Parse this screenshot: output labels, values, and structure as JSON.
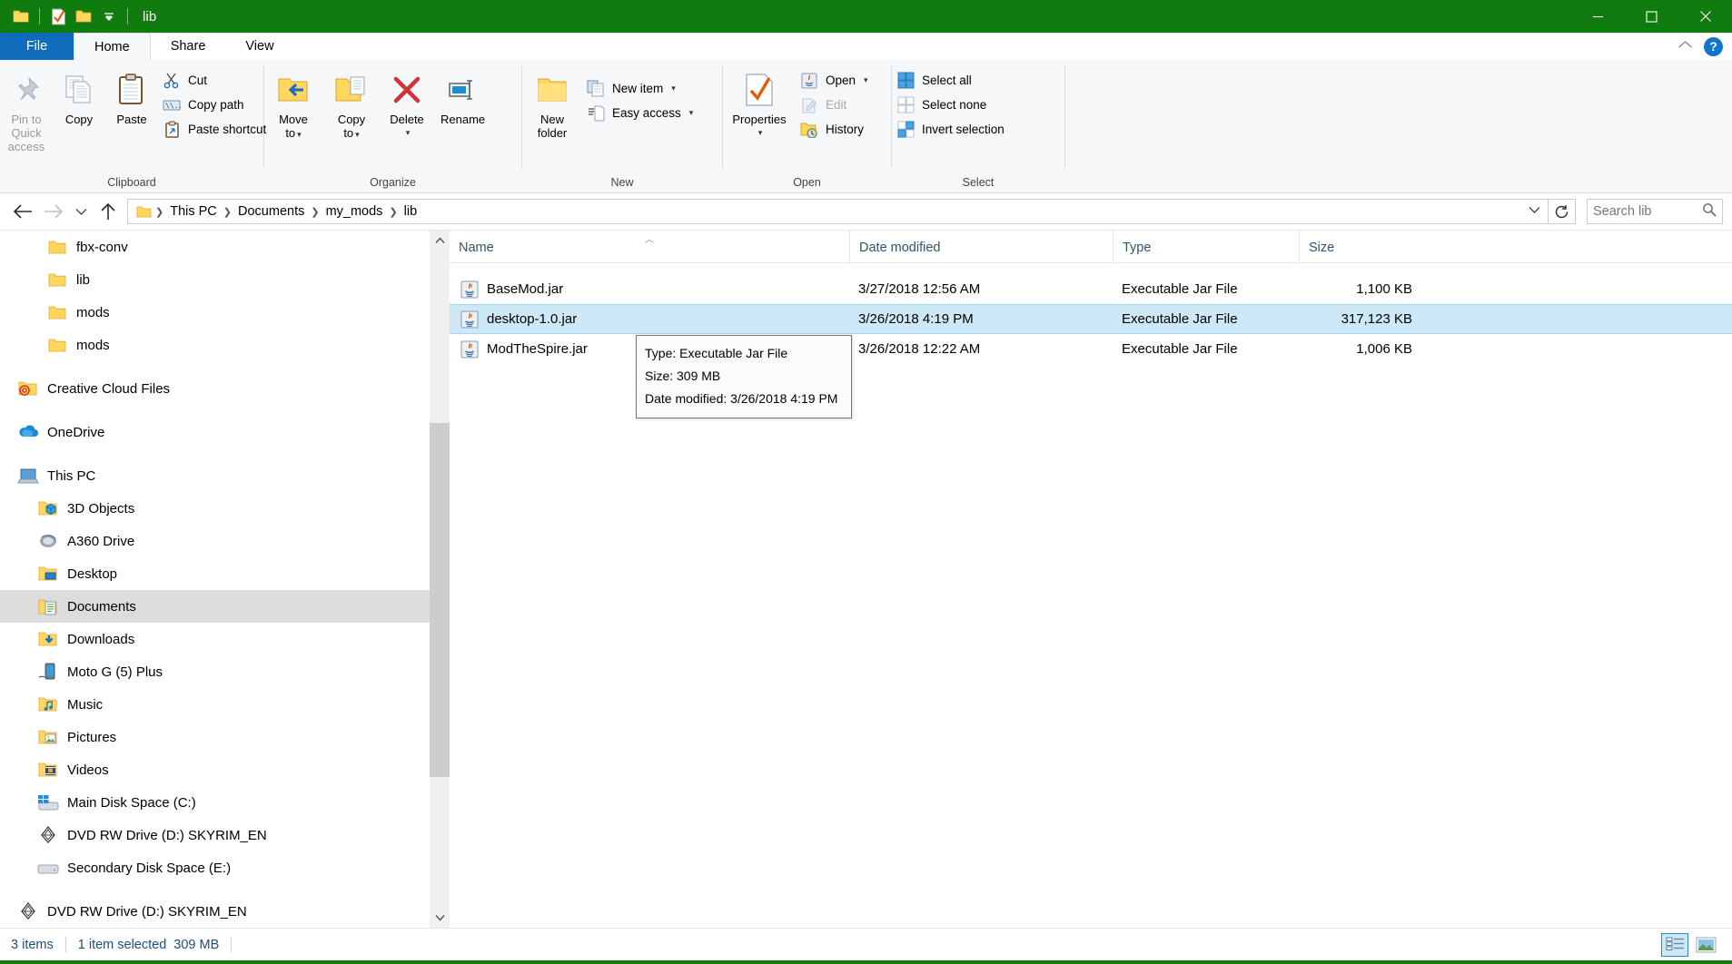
{
  "window": {
    "title": "lib",
    "accent_green": "#107c10",
    "selection_blue": "#cde8f7",
    "controls": {
      "minimize": "minimize-button",
      "maximize": "maximize-button",
      "close": "close-button"
    }
  },
  "quick_access": {
    "items": [
      "folder-icon",
      "properties-check-icon",
      "new-folder-icon",
      "customize-chevron-icon"
    ]
  },
  "tabs": [
    {
      "label": "File",
      "id": "file"
    },
    {
      "label": "Home",
      "id": "home"
    },
    {
      "label": "Share",
      "id": "share"
    },
    {
      "label": "View",
      "id": "view"
    }
  ],
  "ribbon": {
    "collapse_icon": "chevron-up-icon",
    "help_label": "?",
    "groups": [
      {
        "label": "Clipboard",
        "big": [
          {
            "label": "Pin to Quick\naccess",
            "label_line1": "Pin to Quick",
            "label_line2": "access",
            "icon": "pin-icon",
            "disabled": true
          },
          {
            "label": "Copy",
            "icon": "copy-icon",
            "disabled": false
          },
          {
            "label": "Paste",
            "icon": "paste-icon",
            "disabled": false
          }
        ],
        "small": [
          {
            "label": "Cut",
            "icon": "scissors-icon"
          },
          {
            "label": "Copy path",
            "icon": "copy-path-icon"
          },
          {
            "label": "Paste shortcut",
            "icon": "paste-shortcut-icon"
          }
        ]
      },
      {
        "label": "Organize",
        "big": [
          {
            "label_line1": "Move",
            "label_line2": "to",
            "icon": "move-to-icon",
            "caret": true
          },
          {
            "label_line1": "Copy",
            "label_line2": "to",
            "icon": "copy-to-icon",
            "caret": true
          },
          {
            "label_line1": "Delete",
            "label_line2": "",
            "icon": "delete-x-icon",
            "caret": true
          },
          {
            "label_line1": "Rename",
            "label_line2": "",
            "icon": "rename-icon",
            "caret": false
          }
        ],
        "small": []
      },
      {
        "label": "New",
        "big": [
          {
            "label_line1": "New",
            "label_line2": "folder",
            "icon": "new-folder-icon",
            "caret": false
          }
        ],
        "small": [
          {
            "label": "New item",
            "icon": "new-item-icon",
            "caret": true
          },
          {
            "label": "Easy access",
            "icon": "easy-access-icon",
            "caret": true
          }
        ]
      },
      {
        "label": "Open",
        "big": [
          {
            "label_line1": "Properties",
            "label_line2": "",
            "icon": "properties-icon",
            "caret": true
          }
        ],
        "small": [
          {
            "label": "Open",
            "icon": "java-open-icon",
            "caret": true
          },
          {
            "label": "Edit",
            "icon": "edit-icon",
            "disabled": true
          },
          {
            "label": "History",
            "icon": "history-icon"
          }
        ]
      },
      {
        "label": "Select",
        "big": [],
        "small": [
          {
            "label": "Select all",
            "icon": "select-all-icon"
          },
          {
            "label": "Select none",
            "icon": "select-none-icon"
          },
          {
            "label": "Invert selection",
            "icon": "invert-selection-icon"
          }
        ]
      }
    ]
  },
  "addressbar": {
    "back_icon": "back-arrow-icon",
    "forward_icon": "forward-arrow-icon",
    "recent_icon": "recent-locations-chevron-icon",
    "up_icon": "up-arrow-icon",
    "folder_icon": "folder-icon",
    "breadcrumbs": [
      "This PC",
      "Documents",
      "my_mods",
      "lib"
    ],
    "dropdown_icon": "chevron-down-icon",
    "refresh_icon": "refresh-icon",
    "search_placeholder": "Search lib",
    "search_value": "",
    "search_icon": "search-icon"
  },
  "navigation_pane": {
    "items": [
      {
        "label": "fbx-conv",
        "icon": "folder-icon",
        "indent": 2,
        "selected": false
      },
      {
        "label": "lib",
        "icon": "folder-icon",
        "indent": 2,
        "selected": false
      },
      {
        "label": "mods",
        "icon": "folder-icon",
        "indent": 2,
        "selected": false
      },
      {
        "label": "mods",
        "icon": "folder-icon",
        "indent": 2,
        "selected": false
      },
      {
        "label": "Creative Cloud Files",
        "icon": "creative-cloud-icon",
        "indent": 0,
        "selected": false,
        "gap_before": true
      },
      {
        "label": "OneDrive",
        "icon": "onedrive-icon",
        "indent": 0,
        "selected": false,
        "gap_before": true
      },
      {
        "label": "This PC",
        "icon": "this-pc-icon",
        "indent": 0,
        "selected": false,
        "gap_before": true
      },
      {
        "label": "3D Objects",
        "icon": "3d-objects-icon",
        "indent": 1,
        "selected": false
      },
      {
        "label": "A360 Drive",
        "icon": "a360-drive-icon",
        "indent": 1,
        "selected": false
      },
      {
        "label": "Desktop",
        "icon": "desktop-folder-icon",
        "indent": 1,
        "selected": false
      },
      {
        "label": "Documents",
        "icon": "documents-folder-icon",
        "indent": 1,
        "selected": true
      },
      {
        "label": "Downloads",
        "icon": "downloads-folder-icon",
        "indent": 1,
        "selected": false
      },
      {
        "label": "Moto G (5) Plus",
        "icon": "phone-icon",
        "indent": 1,
        "selected": false
      },
      {
        "label": "Music",
        "icon": "music-folder-icon",
        "indent": 1,
        "selected": false
      },
      {
        "label": "Pictures",
        "icon": "pictures-folder-icon",
        "indent": 1,
        "selected": false
      },
      {
        "label": "Videos",
        "icon": "videos-folder-icon",
        "indent": 1,
        "selected": false
      },
      {
        "label": "Main Disk Space (C:)",
        "icon": "windows-drive-icon",
        "indent": 1,
        "selected": false
      },
      {
        "label": "DVD RW Drive (D:) SKYRIM_EN",
        "icon": "dvd-drive-icon",
        "indent": 1,
        "selected": false
      },
      {
        "label": "Secondary Disk Space (E:)",
        "icon": "hard-drive-icon",
        "indent": 1,
        "selected": false
      },
      {
        "label": "DVD RW Drive (D:) SKYRIM_EN",
        "icon": "dvd-drive-icon",
        "indent": 0,
        "selected": false,
        "gap_before": true
      }
    ]
  },
  "file_list": {
    "columns": [
      {
        "label": "Name",
        "sorted": true,
        "sort_dir": "asc"
      },
      {
        "label": "Date modified",
        "sorted": false
      },
      {
        "label": "Type",
        "sorted": false
      },
      {
        "label": "Size",
        "sorted": false
      }
    ],
    "rows": [
      {
        "name": "BaseMod.jar",
        "date_modified": "3/27/2018 12:56 AM",
        "type": "Executable Jar File",
        "size": "1,100 KB",
        "icon": "java-jar-icon",
        "selected": false
      },
      {
        "name": "desktop-1.0.jar",
        "date_modified": "3/26/2018 4:19 PM",
        "type": "Executable Jar File",
        "size": "317,123 KB",
        "icon": "java-jar-icon",
        "selected": true
      },
      {
        "name": "ModTheSpire.jar",
        "date_modified": "3/26/2018 12:22 AM",
        "type": "Executable Jar File",
        "size": "1,006 KB",
        "icon": "java-jar-icon",
        "selected": false
      }
    ]
  },
  "tooltip": {
    "line1": "Type: Executable Jar File",
    "line2": "Size: 309 MB",
    "line3": "Date modified: 3/26/2018 4:19 PM"
  },
  "statusbar": {
    "item_count": "3 items",
    "selection_info": "1 item selected",
    "selection_size": "309 MB",
    "view_details_icon": "details-view-icon",
    "view_large_icon": "large-icons-view-icon"
  }
}
